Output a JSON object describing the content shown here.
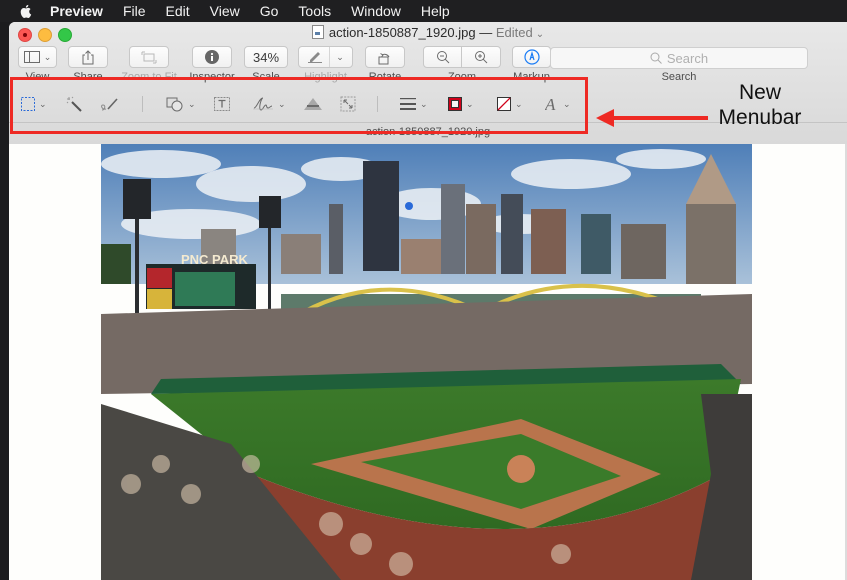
{
  "menubar": {
    "apple_icon": "apple-logo-icon",
    "items": [
      "Preview",
      "File",
      "Edit",
      "View",
      "Go",
      "Tools",
      "Window",
      "Help"
    ]
  },
  "window": {
    "title": "action-1850887_1920.jpg",
    "title_separator": "—",
    "status": "Edited",
    "file_icon": "jpeg-document-icon"
  },
  "toolbar": {
    "view": {
      "label": "View",
      "icon": "sidebar-icon"
    },
    "share": {
      "label": "Share",
      "icon": "share-icon"
    },
    "zoom_to_fit": {
      "label": "Zoom to Fit",
      "icon": "zoom-to-fit-icon",
      "enabled": false
    },
    "inspector": {
      "label": "Inspector",
      "icon": "info-icon"
    },
    "scale": {
      "label": "Scale",
      "value": "34%"
    },
    "highlight": {
      "label": "Highlight",
      "icon": "highlighter-icon",
      "enabled": false
    },
    "rotate": {
      "label": "Rotate",
      "icon": "rotate-icon"
    },
    "zoom": {
      "label": "Zoom",
      "out_icon": "zoom-out-icon",
      "in_icon": "zoom-in-icon"
    },
    "markup": {
      "label": "Markup",
      "icon": "markup-pen-icon"
    },
    "search": {
      "label": "Search",
      "placeholder": "Search"
    }
  },
  "markup_toolbar": {
    "tools": [
      "rectangular-selection-icon",
      "instant-alpha-icon",
      "sketch-icon",
      "shapes-icon",
      "text-box-icon",
      "signature-icon",
      "adjust-color-icon",
      "adjust-size-icon",
      "shape-style-icon",
      "border-color-icon",
      "fill-color-icon",
      "text-style-icon"
    ],
    "border_color": "#d0021b",
    "fill_color": "none"
  },
  "document": {
    "filename": "action-1850887_1920.jpg",
    "image_description": "Aerial view of PNC Park baseball stadium with Pittsburgh skyline"
  },
  "annotation": {
    "line1": "New",
    "line2": "Menubar",
    "color": "#ee2a24"
  }
}
